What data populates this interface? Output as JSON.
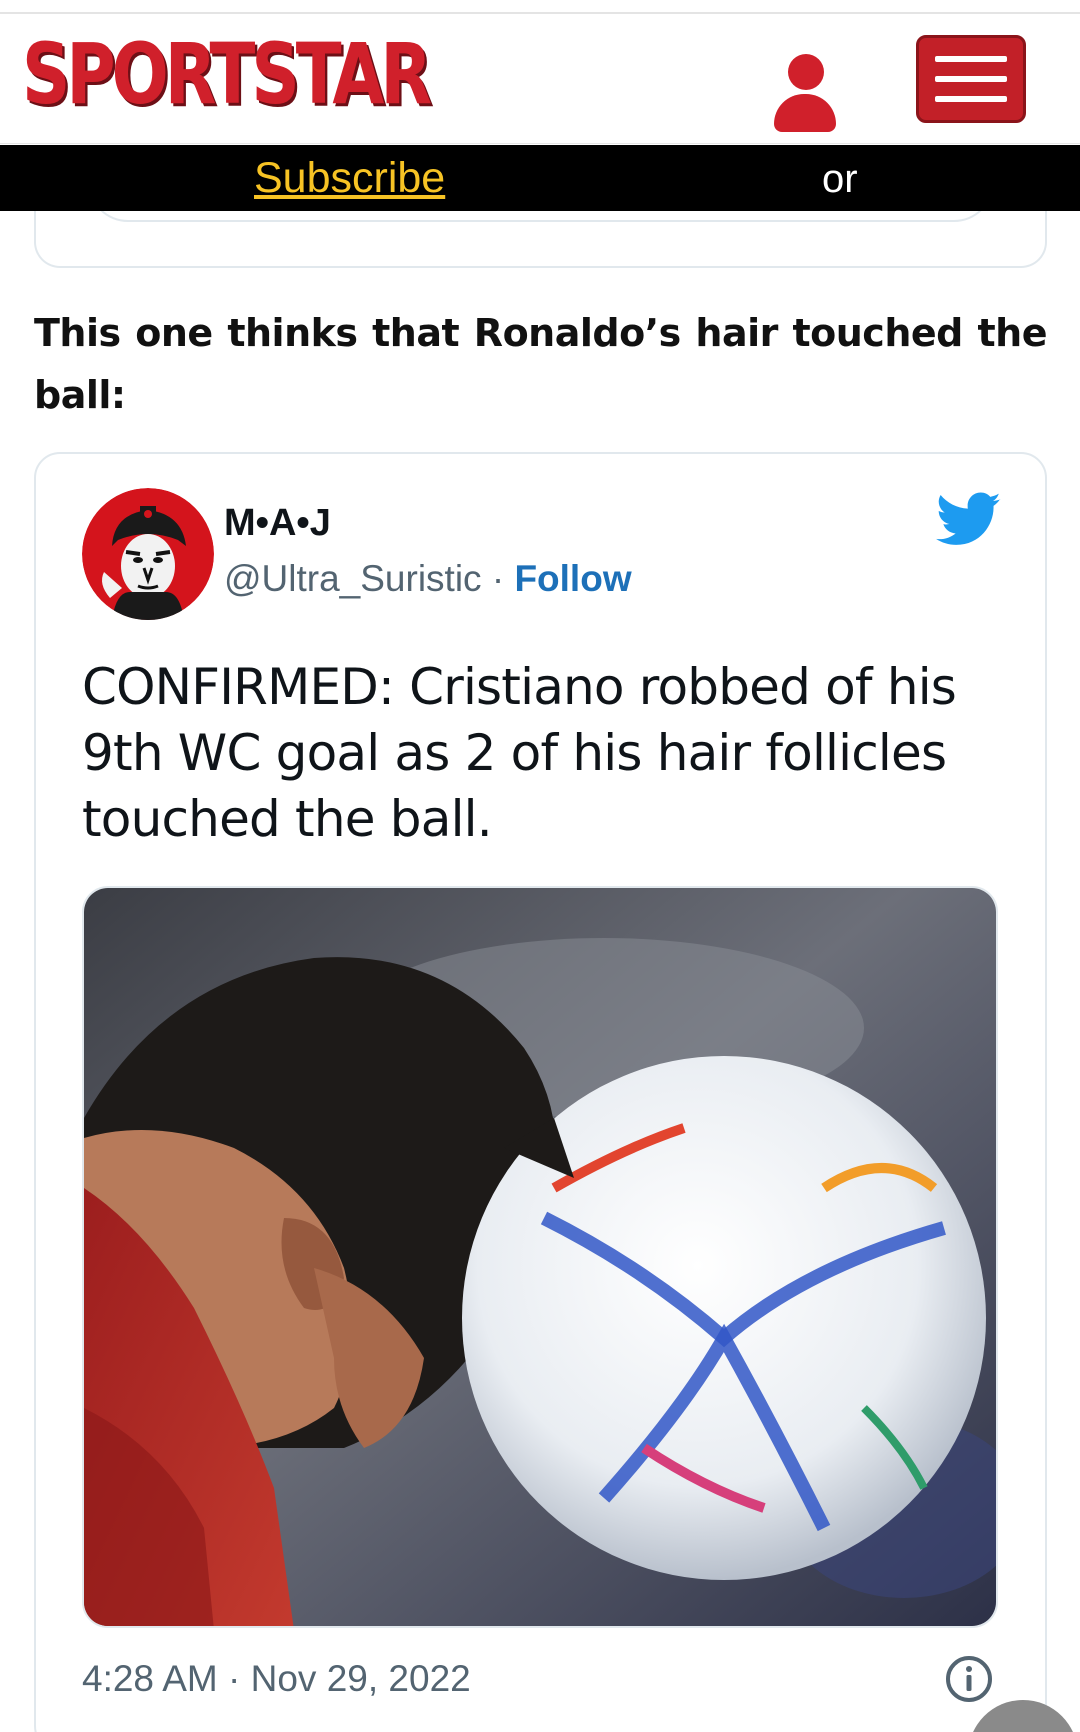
{
  "header": {
    "logo_text": "SPORTSTAR",
    "user_icon": "user-icon",
    "menu_icon": "hamburger-menu-icon",
    "brand_color": "#d0202b"
  },
  "subscribe_bar": {
    "subscribe_label": "Subscribe",
    "or_label": "or"
  },
  "article": {
    "paragraph": "This one thinks that Ronaldo’s hair touched the ball:"
  },
  "tweet": {
    "author_name": "M•A•J",
    "handle": "@Ultra_Suristic",
    "separator": " · ",
    "follow_label": "Follow",
    "text": "CONFIRMED: Cristiano robbed of his 9th WC goal as 2 of his hair follicles touched the ball.",
    "media_description_icon": "photo-image",
    "timestamp": "4:28 AM · Nov 29, 2022",
    "platform_icon": "twitter-bird-icon",
    "info_icon": "info-icon",
    "accent_color": "#1d9bf0"
  }
}
